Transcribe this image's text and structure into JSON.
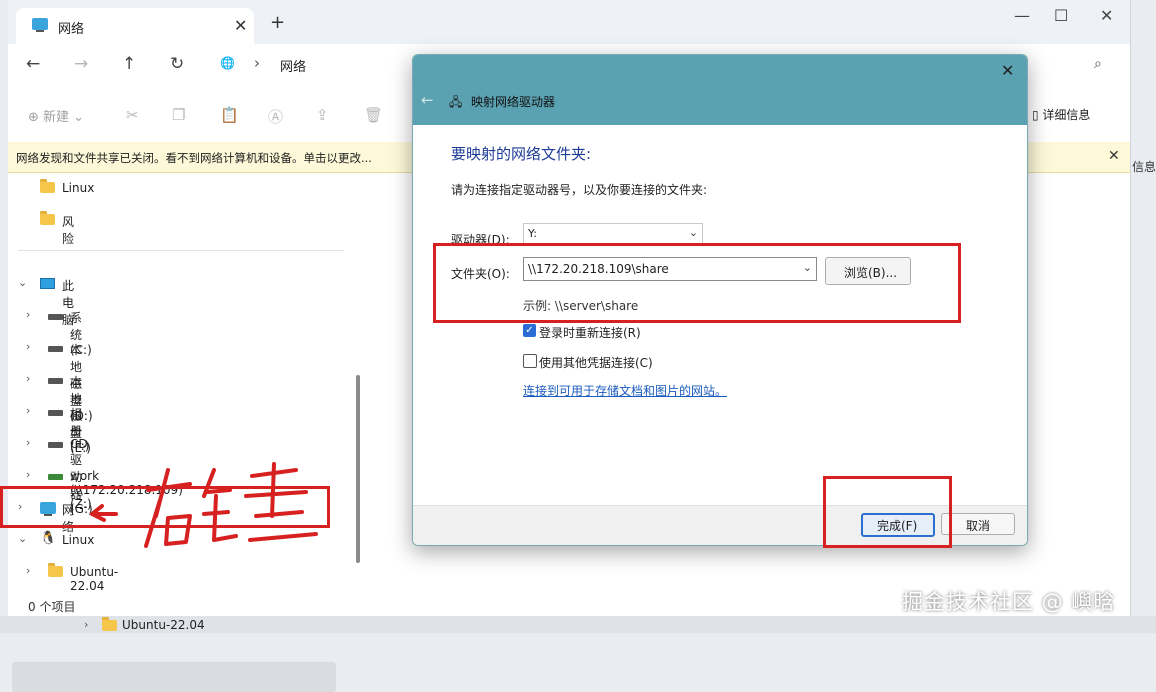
{
  "explorer": {
    "tab_title": "网络",
    "address": "网络",
    "toolbar_new": "新建",
    "details": "详细信息",
    "infobar": "网络发现和文件共享已关闭。看不到网络计算机和设备。单击以更改...",
    "side_info": "信息",
    "status": "0 个项目"
  },
  "sidebar": {
    "items": [
      {
        "label": "Linux"
      },
      {
        "label": "风险"
      },
      {
        "label": "此电脑"
      },
      {
        "label": "系统 (C:)"
      },
      {
        "label": "本地磁盘 (D:)"
      },
      {
        "label": "本地磁盘 (E:)"
      },
      {
        "label": "相册 (F:)"
      },
      {
        "label": "CD 驱动器 (G:)"
      },
      {
        "label": "work (\\\\172.20.218.109) (Z:)"
      },
      {
        "label": "网络"
      },
      {
        "label": "Linux"
      },
      {
        "label": "Ubuntu-22.04"
      }
    ],
    "behind_item": "Ubuntu-22.04"
  },
  "dialog": {
    "title": "映射网络驱动器",
    "heading": "要映射的网络文件夹:",
    "description": "请为连接指定驱动器号，以及你要连接的文件夹:",
    "drive_label": "驱动器(D):",
    "drive_value": "Y:",
    "folder_label": "文件夹(O):",
    "folder_value": "\\\\172.20.218.109\\share",
    "browse": "浏览(B)...",
    "example": "示例: \\\\server\\share",
    "reconnect_label": "登录时重新连接(R)",
    "reconnect_checked": true,
    "creds_label": "使用其他凭据连接(C)",
    "creds_checked": false,
    "link": "连接到可用于存储文档和图片的网站。",
    "finish": "完成(F)",
    "cancel": "取消"
  },
  "annotation": {
    "handwritten": "← 右键",
    "color": "#d72020"
  },
  "watermark": "掘金技术社区 @ 嶼晗"
}
